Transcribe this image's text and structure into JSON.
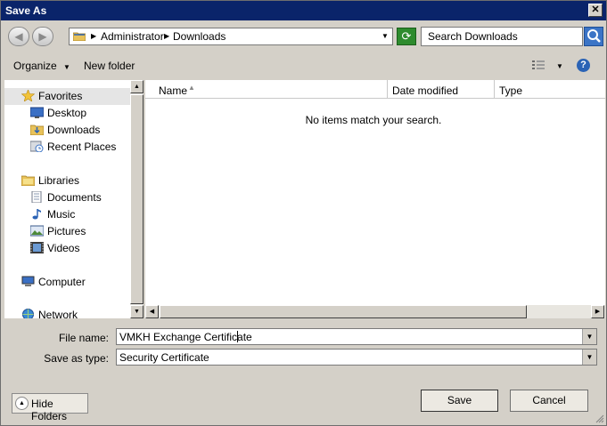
{
  "window": {
    "title": "Save As",
    "close_glyph": "✕"
  },
  "nav": {
    "back_glyph": "◀",
    "forward_glyph": "▶",
    "breadcrumb": [
      "Administrator",
      "Downloads"
    ],
    "refresh_glyph": "⟳",
    "search_placeholder": "Search Downloads"
  },
  "toolbar": {
    "organize_label": "Organize",
    "new_folder_label": "New folder",
    "help_glyph": "?"
  },
  "sidebar": {
    "favorites": "Favorites",
    "desktop": "Desktop",
    "downloads": "Downloads",
    "recent": "Recent Places",
    "libraries": "Libraries",
    "documents": "Documents",
    "music": "Music",
    "pictures": "Pictures",
    "videos": "Videos",
    "computer": "Computer",
    "network": "Network"
  },
  "columns": {
    "name": "Name",
    "date": "Date modified",
    "type": "Type"
  },
  "empty_message": "No items match your search.",
  "form": {
    "file_name_label": "File name:",
    "file_name_value": "VMKH Exchange Certificate",
    "type_label": "Save as type:",
    "type_value": "Security Certificate"
  },
  "buttons": {
    "save": "Save",
    "cancel": "Cancel",
    "hide_folders": "Hide Folders"
  },
  "colors": {
    "title_bar": "#0a246a",
    "dialog_bg": "#d4d0c8",
    "selection": "#e5e5e5"
  }
}
